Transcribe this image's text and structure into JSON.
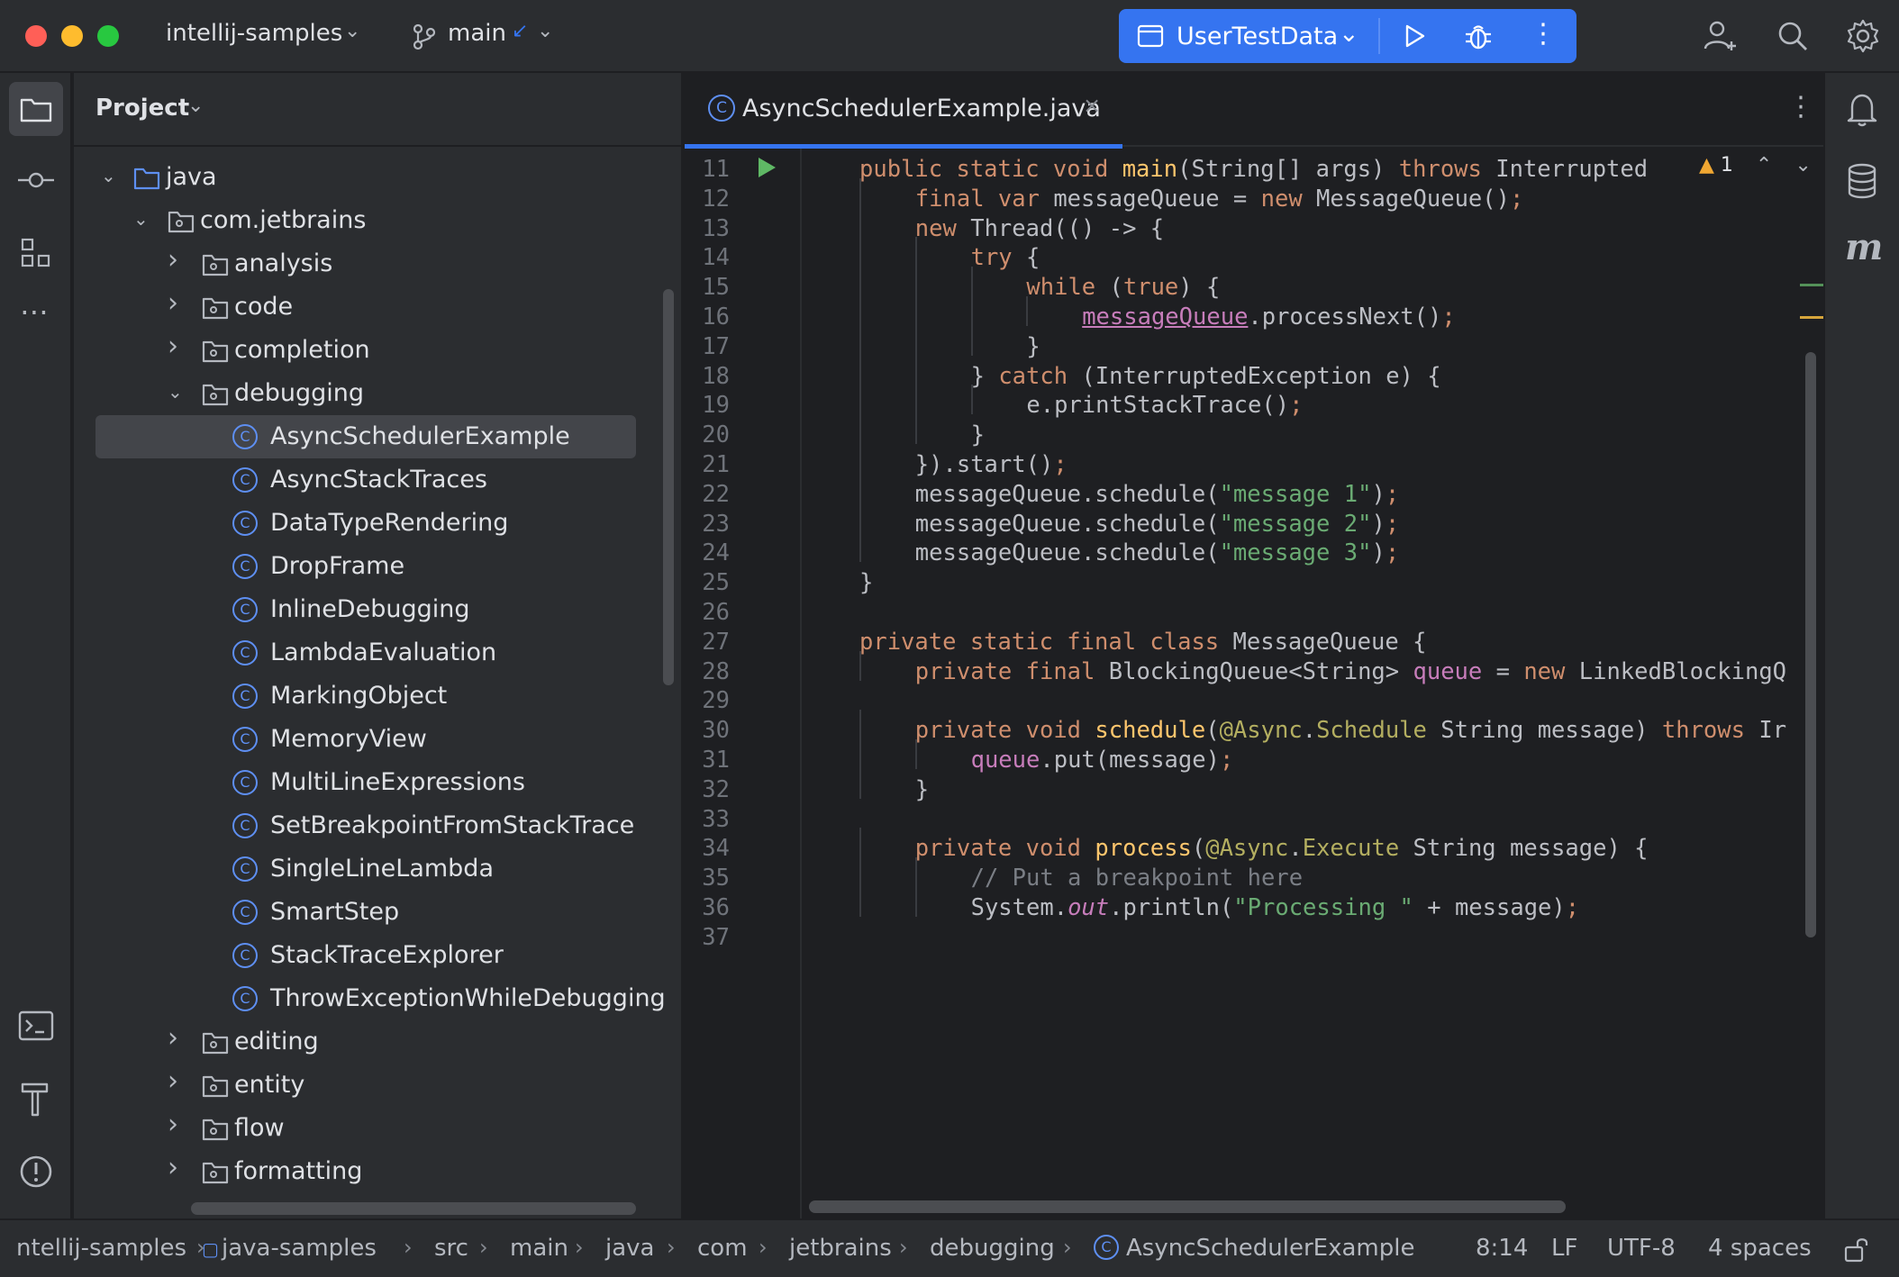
{
  "titlebar": {
    "project": "intellij-samples",
    "branch": "main",
    "run_config": "UserTestData"
  },
  "colors": {
    "accent": "#3574f0",
    "close": "#ff5f57",
    "minimize": "#febc2e",
    "maximize": "#28c840",
    "run_arrow": "#5fb865"
  },
  "project_panel": {
    "title": "Project",
    "tree": [
      {
        "label": "java",
        "depth": 0,
        "kind": "folder",
        "expanded": true
      },
      {
        "label": "com.jetbrains",
        "depth": 1,
        "kind": "package",
        "expanded": true
      },
      {
        "label": "analysis",
        "depth": 2,
        "kind": "package",
        "expanded": false
      },
      {
        "label": "code",
        "depth": 2,
        "kind": "package",
        "expanded": false
      },
      {
        "label": "completion",
        "depth": 2,
        "kind": "package",
        "expanded": false
      },
      {
        "label": "debugging",
        "depth": 2,
        "kind": "package",
        "expanded": true
      },
      {
        "label": "AsyncSchedulerExample",
        "depth": 3,
        "kind": "class",
        "selected": true
      },
      {
        "label": "AsyncStackTraces",
        "depth": 3,
        "kind": "class"
      },
      {
        "label": "DataTypeRendering",
        "depth": 3,
        "kind": "class"
      },
      {
        "label": "DropFrame",
        "depth": 3,
        "kind": "class"
      },
      {
        "label": "InlineDebugging",
        "depth": 3,
        "kind": "class"
      },
      {
        "label": "LambdaEvaluation",
        "depth": 3,
        "kind": "class"
      },
      {
        "label": "MarkingObject",
        "depth": 3,
        "kind": "class"
      },
      {
        "label": "MemoryView",
        "depth": 3,
        "kind": "class"
      },
      {
        "label": "MultiLineExpressions",
        "depth": 3,
        "kind": "class"
      },
      {
        "label": "SetBreakpointFromStackTrace",
        "depth": 3,
        "kind": "class"
      },
      {
        "label": "SingleLineLambda",
        "depth": 3,
        "kind": "class"
      },
      {
        "label": "SmartStep",
        "depth": 3,
        "kind": "class"
      },
      {
        "label": "StackTraceExplorer",
        "depth": 3,
        "kind": "class"
      },
      {
        "label": "ThrowExceptionWhileDebugging",
        "depth": 3,
        "kind": "class"
      },
      {
        "label": "editing",
        "depth": 2,
        "kind": "package",
        "expanded": false
      },
      {
        "label": "entity",
        "depth": 2,
        "kind": "package",
        "expanded": false
      },
      {
        "label": "flow",
        "depth": 2,
        "kind": "package",
        "expanded": false
      },
      {
        "label": "formatting",
        "depth": 2,
        "kind": "package",
        "expanded": false
      }
    ]
  },
  "editor": {
    "tab_title": "AsyncSchedulerExample.java",
    "warning_count": "1",
    "lines": [
      {
        "n": "11",
        "indent": 1,
        "tokens": [
          [
            "kw",
            "public static void "
          ],
          [
            "mth",
            "main"
          ],
          [
            "pl",
            "(String[] args) "
          ],
          [
            "kw",
            "throws "
          ],
          [
            "pl",
            "Interrupted"
          ]
        ]
      },
      {
        "n": "12",
        "indent": 2,
        "tokens": [
          [
            "kw",
            "final var "
          ],
          [
            "pl",
            "messageQueue = "
          ],
          [
            "kw",
            "new "
          ],
          [
            "pl",
            "MessageQueue()"
          ],
          [
            "semi",
            ";"
          ]
        ]
      },
      {
        "n": "13",
        "indent": 2,
        "tokens": [
          [
            "kw",
            "new "
          ],
          [
            "pl",
            "Thread(() -> {"
          ]
        ]
      },
      {
        "n": "14",
        "indent": 3,
        "tokens": [
          [
            "kw",
            "try "
          ],
          [
            "pl",
            "{"
          ]
        ]
      },
      {
        "n": "15",
        "indent": 4,
        "tokens": [
          [
            "kw",
            "while "
          ],
          [
            "pl",
            "("
          ],
          [
            "kw",
            "true"
          ],
          [
            "pl",
            ") {"
          ]
        ]
      },
      {
        "n": "16",
        "indent": 5,
        "tokens": [
          [
            "ul",
            "messageQueue"
          ],
          [
            "pl",
            ".processNext()"
          ],
          [
            "semi",
            ";"
          ]
        ]
      },
      {
        "n": "17",
        "indent": 4,
        "tokens": [
          [
            "pl",
            "}"
          ]
        ]
      },
      {
        "n": "18",
        "indent": 3,
        "tokens": [
          [
            "pl",
            "} "
          ],
          [
            "kw",
            "catch "
          ],
          [
            "pl",
            "(InterruptedException e) {"
          ]
        ]
      },
      {
        "n": "19",
        "indent": 4,
        "tokens": [
          [
            "pl",
            "e.printStackTrace()"
          ],
          [
            "semi",
            ";"
          ]
        ]
      },
      {
        "n": "20",
        "indent": 3,
        "tokens": [
          [
            "pl",
            "}"
          ]
        ]
      },
      {
        "n": "21",
        "indent": 2,
        "tokens": [
          [
            "pl",
            "}).start()"
          ],
          [
            "semi",
            ";"
          ]
        ]
      },
      {
        "n": "22",
        "indent": 2,
        "tokens": [
          [
            "pl",
            "messageQueue.schedule("
          ],
          [
            "str",
            "\"message 1\""
          ],
          [
            "pl",
            ")"
          ],
          [
            "semi",
            ";"
          ]
        ]
      },
      {
        "n": "23",
        "indent": 2,
        "tokens": [
          [
            "pl",
            "messageQueue.schedule("
          ],
          [
            "str",
            "\"message 2\""
          ],
          [
            "pl",
            ")"
          ],
          [
            "semi",
            ";"
          ]
        ]
      },
      {
        "n": "24",
        "indent": 2,
        "tokens": [
          [
            "pl",
            "messageQueue.schedule("
          ],
          [
            "str",
            "\"message 3\""
          ],
          [
            "pl",
            ")"
          ],
          [
            "semi",
            ";"
          ]
        ]
      },
      {
        "n": "25",
        "indent": 1,
        "tokens": [
          [
            "pl",
            "}"
          ]
        ]
      },
      {
        "n": "26",
        "indent": 0,
        "tokens": []
      },
      {
        "n": "27",
        "indent": 1,
        "tokens": [
          [
            "kw",
            "private static final class "
          ],
          [
            "pl",
            "MessageQueue {"
          ]
        ]
      },
      {
        "n": "28",
        "indent": 2,
        "tokens": [
          [
            "kw",
            "private final "
          ],
          [
            "pl",
            "BlockingQueue<String> "
          ],
          [
            "fld",
            "queue"
          ],
          [
            "pl",
            " = "
          ],
          [
            "kw",
            "new "
          ],
          [
            "pl",
            "LinkedBlockingQ"
          ]
        ]
      },
      {
        "n": "29",
        "indent": 0,
        "tokens": []
      },
      {
        "n": "30",
        "indent": 2,
        "tokens": [
          [
            "kw",
            "private void "
          ],
          [
            "mth",
            "schedule"
          ],
          [
            "pl",
            "("
          ],
          [
            "ann",
            "@Async"
          ],
          [
            "pl",
            "."
          ],
          [
            "ann",
            "Schedule "
          ],
          [
            "pl",
            "String message) "
          ],
          [
            "kw",
            "throws "
          ],
          [
            "pl",
            "Ir"
          ]
        ]
      },
      {
        "n": "31",
        "indent": 3,
        "tokens": [
          [
            "fld",
            "queue"
          ],
          [
            "pl",
            ".put(message)"
          ],
          [
            "semi",
            ";"
          ]
        ]
      },
      {
        "n": "32",
        "indent": 2,
        "tokens": [
          [
            "pl",
            "}"
          ]
        ]
      },
      {
        "n": "33",
        "indent": 0,
        "tokens": []
      },
      {
        "n": "34",
        "indent": 2,
        "tokens": [
          [
            "kw",
            "private void "
          ],
          [
            "mth",
            "process"
          ],
          [
            "pl",
            "("
          ],
          [
            "ann",
            "@Async"
          ],
          [
            "pl",
            "."
          ],
          [
            "ann",
            "Execute "
          ],
          [
            "pl",
            "String message) {"
          ]
        ]
      },
      {
        "n": "35",
        "indent": 3,
        "tokens": [
          [
            "cmt",
            "// Put a breakpoint here"
          ]
        ]
      },
      {
        "n": "36",
        "indent": 3,
        "tokens": [
          [
            "pl",
            "System."
          ],
          [
            "it",
            "out"
          ],
          [
            "pl",
            ".println("
          ],
          [
            "str",
            "\"Processing \""
          ],
          [
            "pl",
            " + message)"
          ],
          [
            "semi",
            ";"
          ]
        ]
      },
      {
        "n": "37",
        "indent": 0,
        "tokens": []
      }
    ]
  },
  "statusbar": {
    "breadcrumbs": [
      "ntellij-samples",
      "java-samples",
      "src",
      "main",
      "java",
      "com",
      "jetbrains",
      "debugging",
      "AsyncSchedulerExample"
    ],
    "position": "8:14",
    "line_ending": "LF",
    "encoding": "UTF-8",
    "indent": "4 spaces"
  }
}
